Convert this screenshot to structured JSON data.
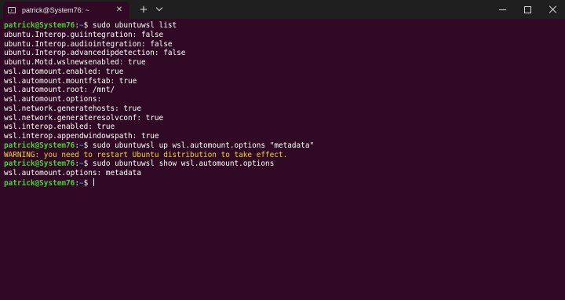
{
  "window": {
    "tab_title": "patrick@System76: ~",
    "tab_close_icon": "close-icon",
    "new_tab_icon": "plus-icon",
    "dropdown_icon": "chevron-down-icon",
    "controls": [
      "minimize-icon",
      "maximize-icon",
      "close-icon"
    ]
  },
  "colors": {
    "background": "#300a24",
    "prompt_user": "#4ecf3a",
    "prompt_path": "#4a7fd8",
    "warning": "#f3d230",
    "text": "#ffffff"
  },
  "terminal": {
    "lines": [
      {
        "user": "patrick@System76",
        "path": "~",
        "symbol": "$ ",
        "cmd": "sudo ubuntuwsl list"
      },
      {
        "out": "ubuntu.Interop.guiintegration: false"
      },
      {
        "out": "ubuntu.Interop.audiointegration: false"
      },
      {
        "out": "ubuntu.Interop.advancedipdetection: false"
      },
      {
        "out": "ubuntu.Motd.wslnewsenabled: true"
      },
      {
        "out": "wsl.automount.enabled: true"
      },
      {
        "out": "wsl.automount.mountfstab: true"
      },
      {
        "out": "wsl.automount.root: /mnt/"
      },
      {
        "out": "wsl.automount.options:"
      },
      {
        "out": "wsl.network.generatehosts: true"
      },
      {
        "out": "wsl.network.generateresolvconf: true"
      },
      {
        "out": "wsl.interop.enabled: true"
      },
      {
        "out": "wsl.interop.appendwindowspath: true"
      },
      {
        "user": "patrick@System76",
        "path": "~",
        "symbol": "$ ",
        "cmd": "sudo ubuntuwsl up wsl.automount.options \"metadata\""
      },
      {
        "warn": "WARNING: you need to restart Ubuntu distribution to take effect."
      },
      {
        "user": "patrick@System76",
        "path": "~",
        "symbol": "$ ",
        "cmd": "sudo ubuntuwsl show wsl.automount.options"
      },
      {
        "out": "wsl.automount.options: metadata"
      },
      {
        "user": "patrick@System76",
        "path": "~",
        "symbol": "$ ",
        "cmd": "",
        "cursor": true
      }
    ]
  }
}
